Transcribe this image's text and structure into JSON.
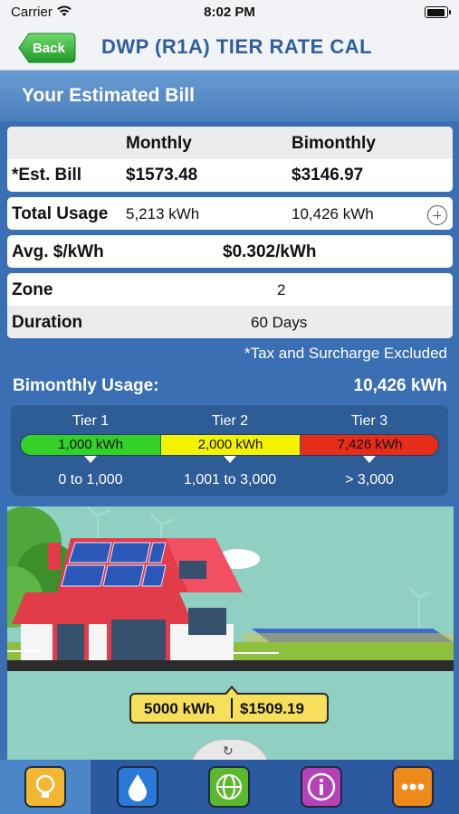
{
  "status_bar": {
    "carrier": "Carrier",
    "time": "8:02 PM"
  },
  "nav": {
    "back_label": "Back",
    "title": "DWP (R1A) TIER RATE CAL"
  },
  "header": {
    "title": "Your Estimated Bill"
  },
  "bill": {
    "col_monthly": "Monthly",
    "col_bimonthly": "Bimonthly",
    "est_label": "*Est. Bill",
    "est_monthly": "$1573.48",
    "est_bimonthly": "$3146.97",
    "usage_label": "Total Usage",
    "usage_monthly": "5,213 kWh",
    "usage_bimonthly": "10,426 kWh",
    "avg_label": "Avg. $/kWh",
    "avg_value": "$0.302/kWh",
    "zone_label": "Zone",
    "zone_value": "2",
    "duration_label": "Duration",
    "duration_value": "60 Days"
  },
  "tax_note": "*Tax and Surcharge Excluded",
  "bimonthly_usage": {
    "label": "Bimonthly Usage:",
    "value": "10,426 kWh"
  },
  "tiers": [
    {
      "name": "Tier 1",
      "usage": "1,000 kWh",
      "range": "0 to 1,000",
      "color": "#34d12b"
    },
    {
      "name": "Tier 2",
      "usage": "2,000 kWh",
      "range": "1,001 to 3,000",
      "color": "#f3f300"
    },
    {
      "name": "Tier 3",
      "usage": "7,426 kWh",
      "range": "> 3,000",
      "color": "#e82c1a"
    }
  ],
  "slider": {
    "kwh": "5000 kWh",
    "amount": "$1509.19",
    "knob_icon": "refresh-icon"
  },
  "tabs": [
    {
      "name": "lightbulb-icon",
      "color": "#f2b632",
      "selected": true
    },
    {
      "name": "water-drop-icon",
      "color": "#2a78d8",
      "selected": false
    },
    {
      "name": "globe-icon",
      "color": "#5cb82d",
      "selected": false
    },
    {
      "name": "info-icon",
      "color": "#b441b8",
      "selected": false
    },
    {
      "name": "more-icon",
      "color": "#ee8a1c",
      "selected": false
    }
  ]
}
